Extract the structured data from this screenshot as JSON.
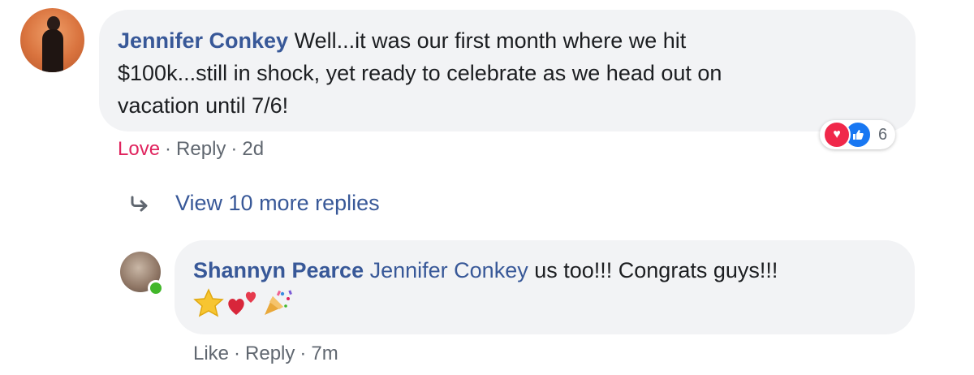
{
  "comment": {
    "author": "Jennifer Conkey",
    "text_line1": " Well...it was our first month where we hit",
    "text_line2": "$100k...still in shock, yet ready to celebrate as we head out on",
    "text_line3": "vacation until 7/6!",
    "reactions_count": "6",
    "reaction_icons": [
      "love-icon",
      "like-icon"
    ],
    "actions": {
      "love": "Love",
      "reply": "Reply",
      "time": "2d"
    }
  },
  "view_more": {
    "label": "View 10 more replies"
  },
  "reply": {
    "author": "Shannyn Pearce",
    "mention": "Jennifer Conkey",
    "text": " us too!!! Congrats guys!!!",
    "emojis": [
      "star-emoji",
      "hearts-emoji",
      "party-popper-emoji"
    ],
    "actions": {
      "like": "Like",
      "reply": "Reply",
      "time": "7m"
    }
  },
  "colors": {
    "link": "#385898",
    "love": "#e0245e",
    "bubble": "#f2f3f5",
    "meta": "#606770",
    "online": "#42b72a"
  },
  "separator": "·"
}
